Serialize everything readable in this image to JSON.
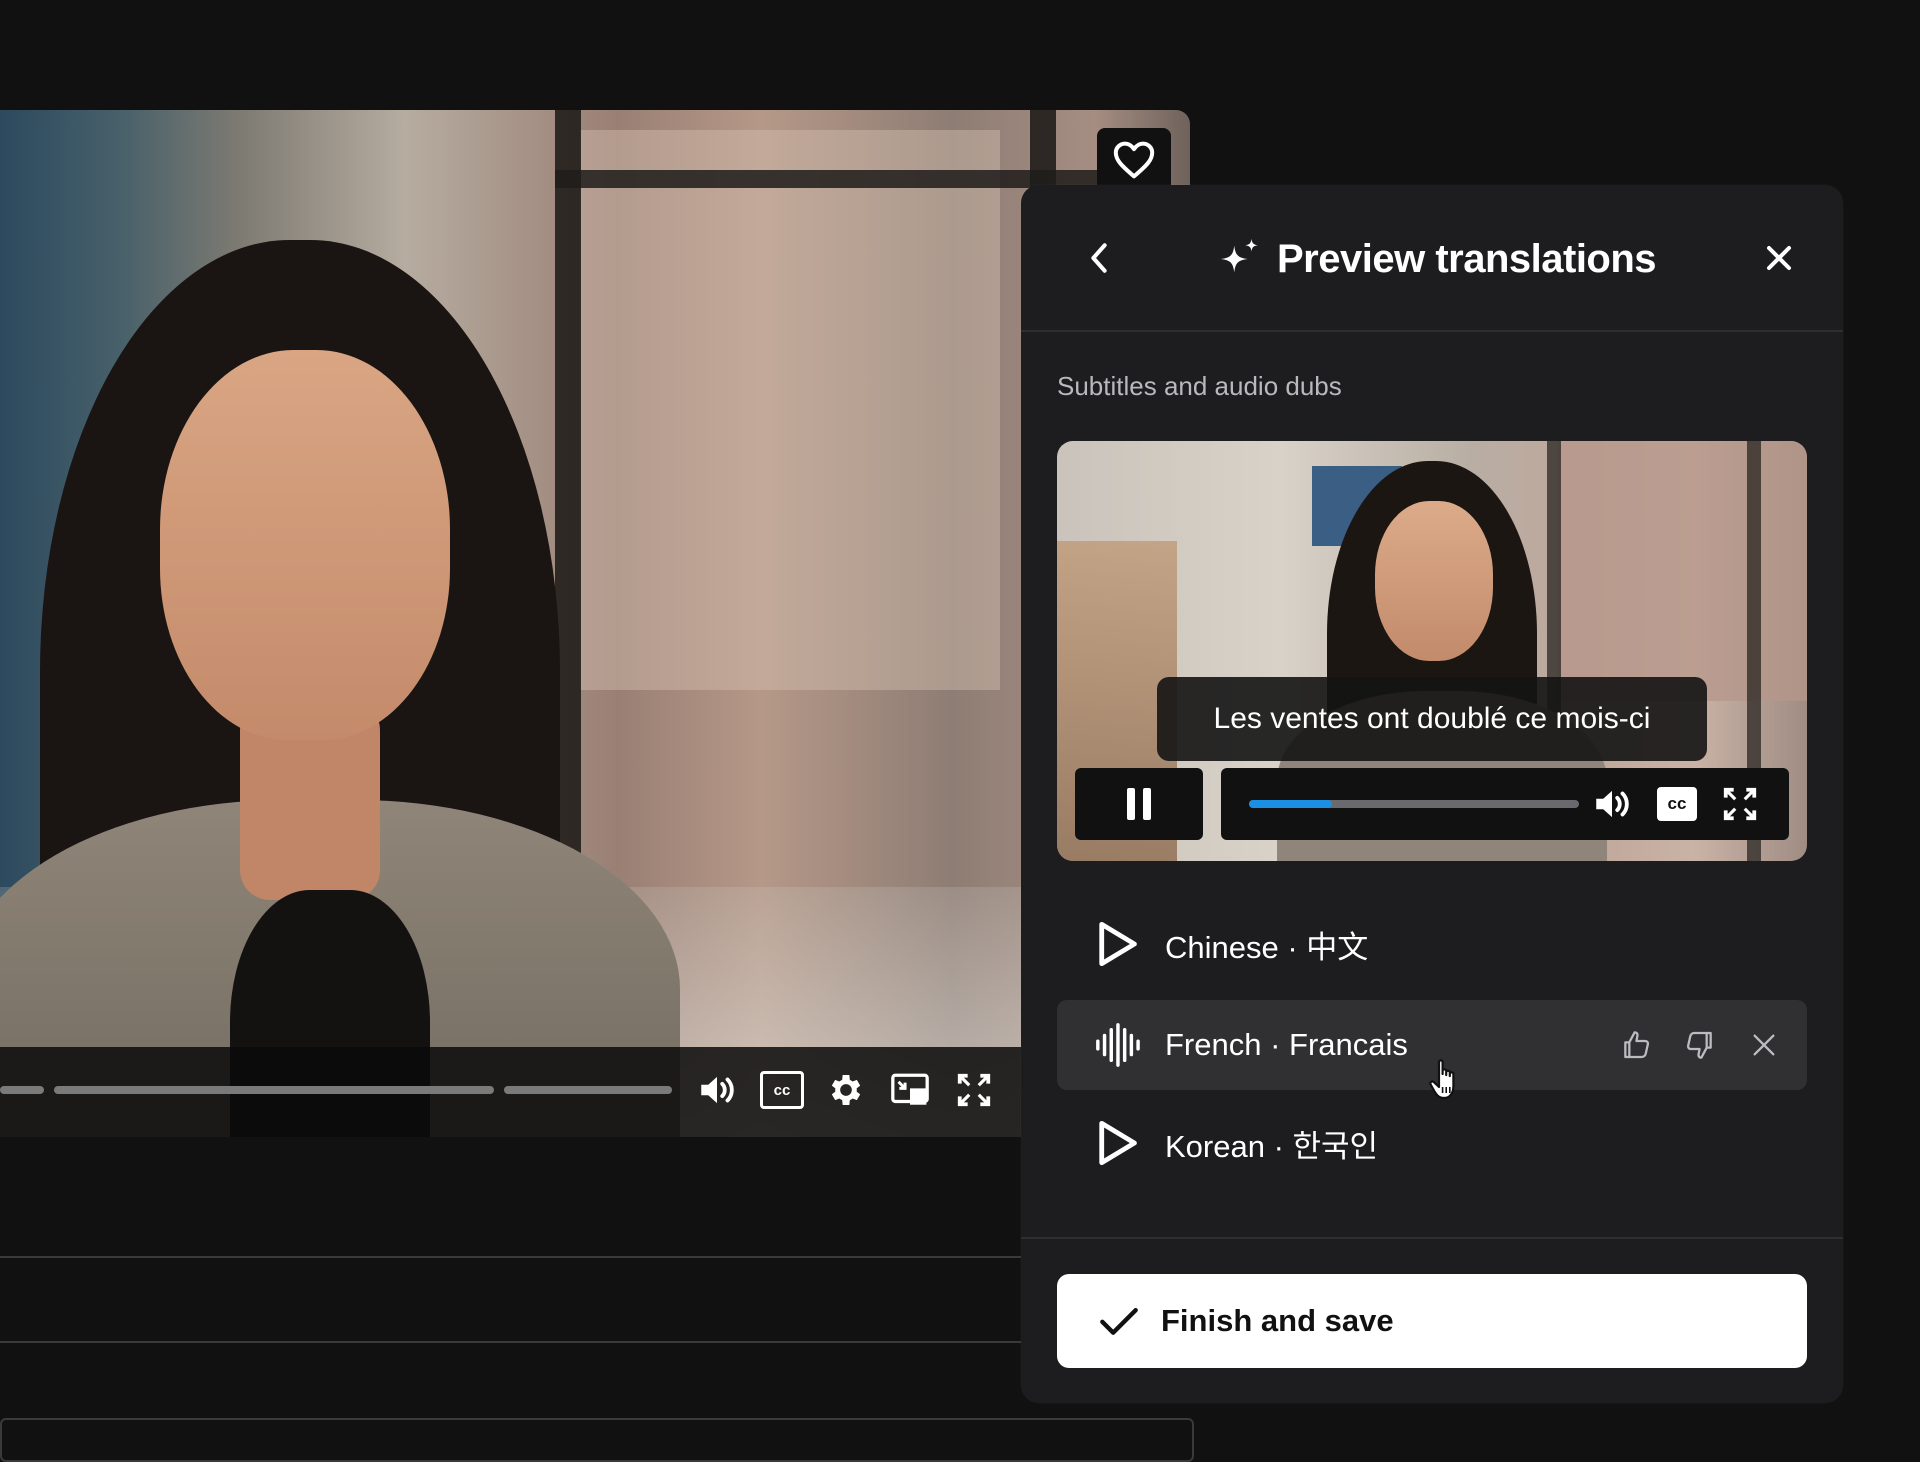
{
  "panel": {
    "title": "Preview translations",
    "section_label": "Subtitles and audio dubs",
    "back_icon": "chevron-left-icon",
    "close_icon": "close-icon",
    "title_icon": "sparkle-icon"
  },
  "preview_player": {
    "caption": "Les ventes ont doublé ce mois-ci",
    "progress": 0.25,
    "state": "playing",
    "cc_label": "cc",
    "accent_color": "#1a8fe3"
  },
  "languages": [
    {
      "label": "Chinese · 中文",
      "state": "idle",
      "icon": "play-icon"
    },
    {
      "label": "French · Francais",
      "state": "playing",
      "icon": "audio-wave-icon",
      "actions": [
        "thumbs-up-icon",
        "thumbs-down-icon",
        "close-icon"
      ]
    },
    {
      "label": "Korean · 한국인",
      "state": "idle",
      "icon": "play-icon"
    }
  ],
  "finish": {
    "label": "Finish and save",
    "icon": "check-icon"
  },
  "main_player": {
    "cc_label": "cc",
    "controls": [
      "volume-icon",
      "cc-icon",
      "settings-icon",
      "picture-in-picture-icon",
      "fullscreen-icon"
    ],
    "favorite_icon": "heart-icon"
  }
}
